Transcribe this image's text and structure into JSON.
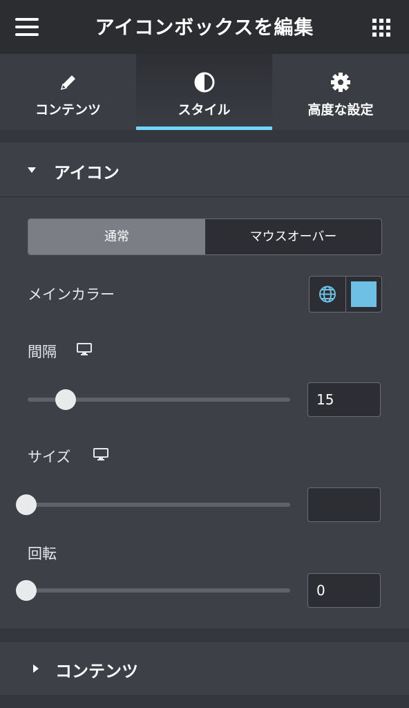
{
  "header": {
    "title": "アイコンボックスを編集",
    "menu_icon": "hamburger-icon",
    "grid_icon": "apps-grid-icon"
  },
  "tabs": [
    {
      "label": "コンテンツ",
      "icon": "pencil-icon",
      "active": false
    },
    {
      "label": "スタイル",
      "icon": "contrast-icon",
      "active": true
    },
    {
      "label": "高度な設定",
      "icon": "gear-icon",
      "active": false
    }
  ],
  "section_icon": {
    "title": "アイコン",
    "state_toggle": {
      "normal": "通常",
      "hover": "マウスオーバー",
      "selected": "通常"
    },
    "main_color": {
      "label": "メインカラー",
      "value": "#6ec1e4"
    },
    "spacing": {
      "label": "間隔",
      "value": "15",
      "slider_fraction": 0.15
    },
    "size": {
      "label": "サイズ",
      "value": "",
      "slider_fraction": 0
    },
    "rotate": {
      "label": "回転",
      "value": "0",
      "slider_fraction": 0
    }
  },
  "section_content": {
    "title": "コンテンツ"
  },
  "colors": {
    "accent": "#71d7f7",
    "swatch": "#6ec1e4"
  }
}
